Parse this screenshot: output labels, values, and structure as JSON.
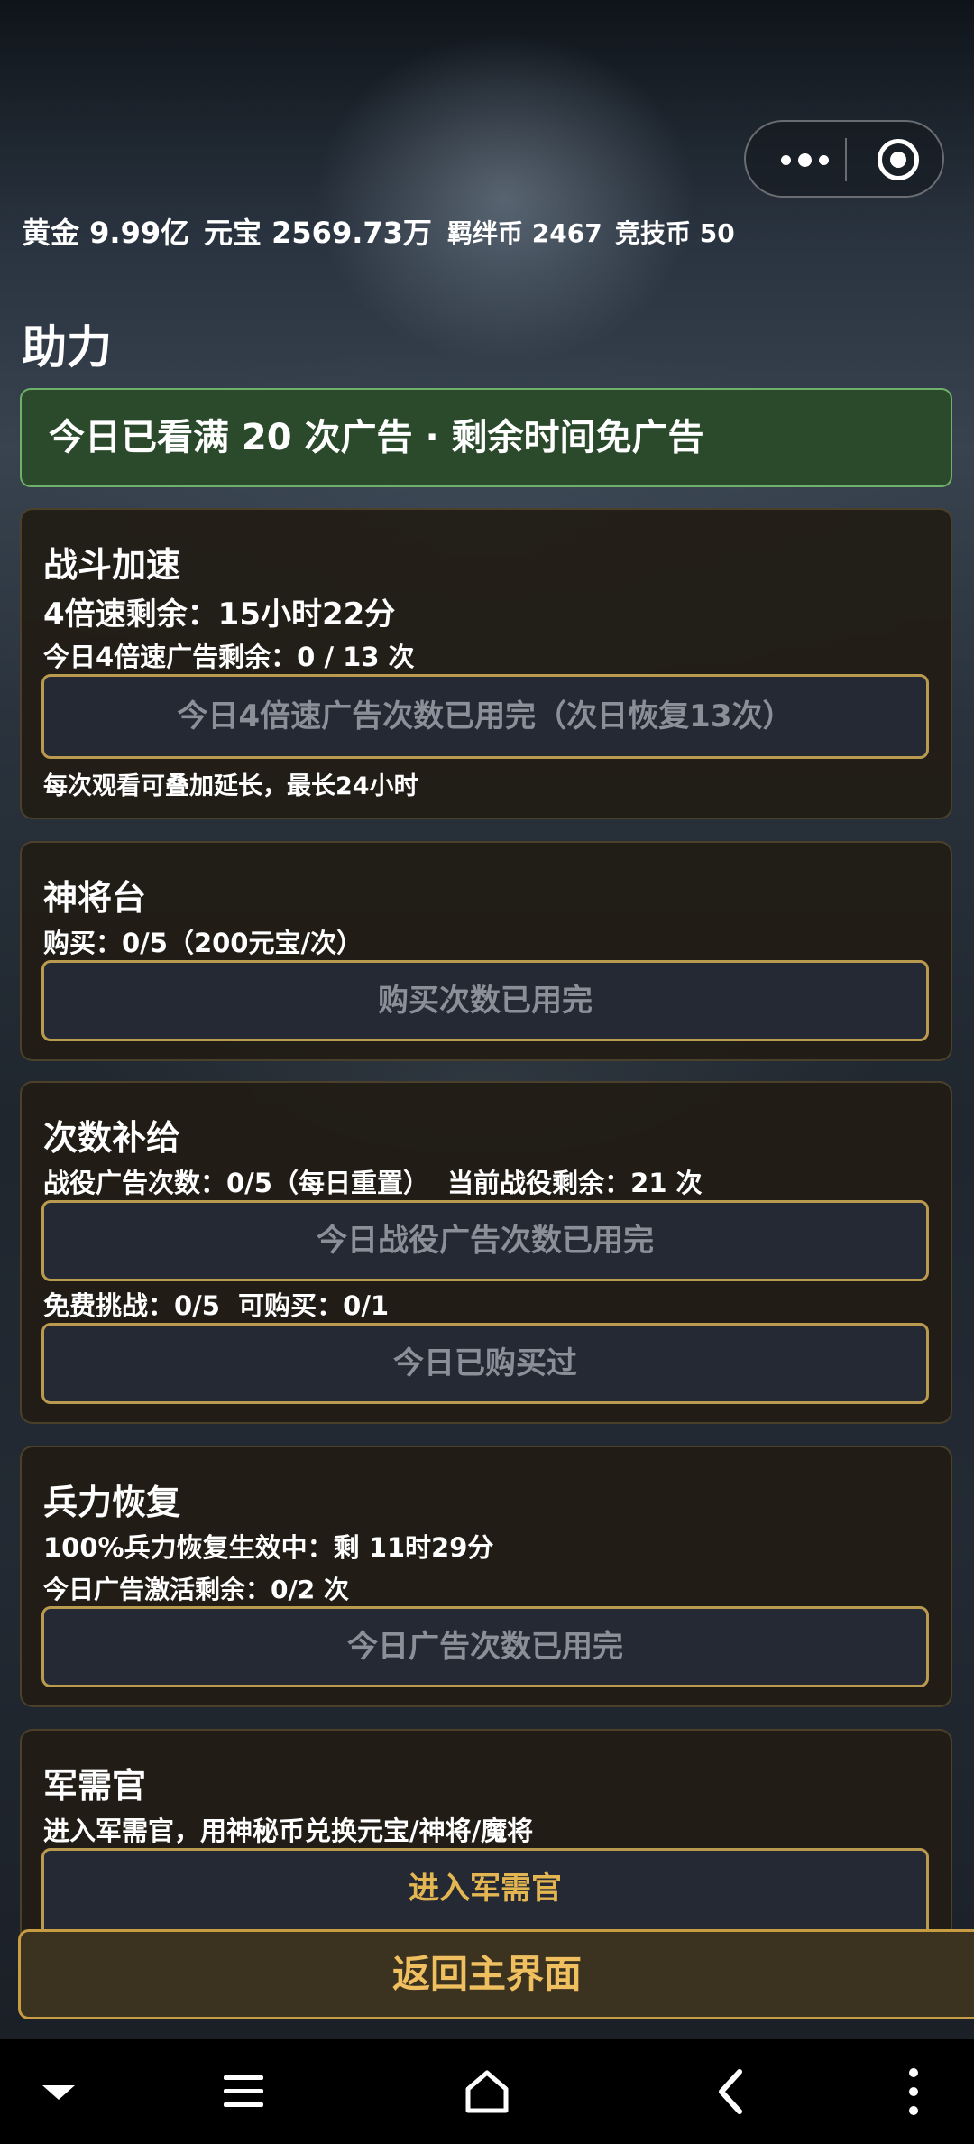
{
  "currency": {
    "gold": "黄金 9.99亿",
    "yuanbao": "元宝 2569.73万",
    "jiban": "羁绊币 2467",
    "arena": "竞技币 50"
  },
  "page_title": "助力",
  "banner": "今日已看满 20 次广告 · 剩余时间免广告",
  "cards": {
    "speed": {
      "title": "战斗加速",
      "remaining": "4倍速剩余：15小时22分",
      "ads_left": "今日4倍速广告剩余：0 / 13 次",
      "button": "今日4倍速广告次数已用完（次日恢复13次）",
      "note": "每次观看可叠加延长，最长24小时"
    },
    "shrine": {
      "title": "神将台",
      "purchase": "购买：0/5（200元宝/次）",
      "button": "购买次数已用完"
    },
    "supply": {
      "title": "次数补给",
      "campaign_line": "战役广告次数：0/5（每日重置）  当前战役剩余：21 次",
      "campaign_button": "今日战役广告次数已用完",
      "free_line": "免费挑战：0/5  可购买：0/1",
      "buy_button": "今日已购买过"
    },
    "troops": {
      "title": "兵力恢复",
      "status": "100%兵力恢复生效中：剩 11时29分",
      "ads_left": "今日广告激活剩余：0/2 次",
      "button": "今日广告次数已用完"
    },
    "quartermaster": {
      "title": "军需官",
      "desc": "进入军需官，用神秘币兑换元宝/神将/魔将",
      "button": "进入军需官"
    }
  },
  "return_button": "返回主界面",
  "icons": {
    "more": "more-dots-icon",
    "close": "target-close-icon",
    "nav": [
      "chevron-down-icon",
      "menu-icon",
      "home-icon",
      "back-icon",
      "more-vertical-icon"
    ]
  },
  "colors": {
    "banner_bg": "#2b4a2c",
    "banner_border": "#6fb06a",
    "button_border": "#b99a4f",
    "active_text": "#e3b652",
    "disabled_text": "#8c8f98"
  }
}
